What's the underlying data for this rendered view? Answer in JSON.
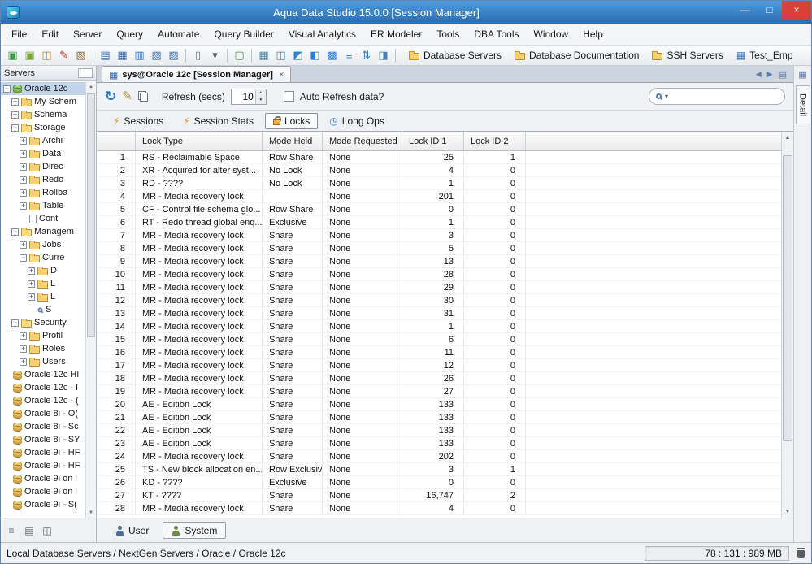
{
  "window": {
    "title": "Aqua Data Studio 15.0.0 [Session Manager]",
    "controls": {
      "minimize": "—",
      "maximize": "□",
      "close": "×"
    }
  },
  "menubar": {
    "items": [
      "File",
      "Edit",
      "Server",
      "Query",
      "Automate",
      "Query Builder",
      "Visual Analytics",
      "ER Modeler",
      "Tools",
      "DBA Tools",
      "Window",
      "Help"
    ]
  },
  "toolbar": {
    "icons": [
      {
        "name": "register-server-icon",
        "glyph": "▣",
        "color": "#3f9b4a"
      },
      {
        "name": "register-server-group-icon",
        "glyph": "▣",
        "color": "#7aa43c"
      },
      {
        "name": "import-servers-icon",
        "glyph": "◫",
        "color": "#b5893a"
      },
      {
        "name": "edit-server-icon",
        "glyph": "✎",
        "color": "#c0392b"
      },
      {
        "name": "scripting-icon",
        "glyph": "▧",
        "color": "#8e6f3a"
      },
      {
        "sep": true
      },
      {
        "name": "query-analyzer-icon",
        "glyph": "▤",
        "color": "#3a6fb0"
      },
      {
        "name": "results-grid-icon",
        "glyph": "▦",
        "color": "#3a6fb0"
      },
      {
        "name": "pin-results-icon",
        "glyph": "▥",
        "color": "#3a6fb0"
      },
      {
        "name": "export-grid-icon",
        "glyph": "▧",
        "color": "#3a6fb0"
      },
      {
        "name": "open-table-icon",
        "glyph": "▨",
        "color": "#3a6fb0"
      },
      {
        "sep": true
      },
      {
        "name": "paste-icon",
        "glyph": "▯",
        "color": "#777777"
      },
      {
        "name": "paste-options-icon",
        "glyph": "▾",
        "color": "#555555"
      },
      {
        "sep": true
      },
      {
        "name": "server-monitor-icon",
        "glyph": "▢",
        "color": "#4a8f4a"
      },
      {
        "sep": true
      },
      {
        "name": "grid-view-icon",
        "glyph": "▦",
        "color": "#4a7fb5"
      },
      {
        "name": "column-headers-icon",
        "glyph": "◫",
        "color": "#4a7fb5"
      },
      {
        "name": "split-top-icon",
        "glyph": "◩",
        "color": "#2a7fd4"
      },
      {
        "name": "split-left-icon",
        "glyph": "◧",
        "color": "#2a7fd4"
      },
      {
        "name": "grid-all-icon",
        "glyph": "▩",
        "color": "#2a7fd4"
      },
      {
        "name": "row-lines-icon",
        "glyph": "≡",
        "color": "#4a7fb5"
      },
      {
        "name": "sort-rows-icon",
        "glyph": "⇅",
        "color": "#4a7fb5"
      },
      {
        "name": "freeze-pane-icon",
        "glyph": "◨",
        "color": "#4a7fb5"
      },
      {
        "sep": true
      }
    ],
    "labeled_buttons": [
      {
        "name": "database-servers-button",
        "label": "Database Servers",
        "icon": "folder-icon"
      },
      {
        "name": "database-documentation-button",
        "label": "Database Documentation",
        "icon": "folder-icon"
      },
      {
        "name": "ssh-servers-button",
        "label": "SSH Servers",
        "icon": "folder-icon"
      },
      {
        "name": "test-emp-button",
        "label": "Test_Emp",
        "icon": "table-icon"
      }
    ]
  },
  "sidebar": {
    "header": "Servers",
    "tree": [
      {
        "label": "Oracle 12c",
        "level": 0,
        "toggle": "open",
        "icon": "db-green",
        "selected": true
      },
      {
        "label": "My Schem",
        "level": 1,
        "toggle": "closed",
        "icon": "folder"
      },
      {
        "label": "Schema",
        "level": 1,
        "toggle": "closed",
        "icon": "folder"
      },
      {
        "label": "Storage",
        "level": 1,
        "toggle": "open",
        "icon": "folder-open"
      },
      {
        "label": "Archi",
        "level": 2,
        "toggle": "closed",
        "icon": "folder"
      },
      {
        "label": "Data",
        "level": 2,
        "toggle": "closed",
        "icon": "folder"
      },
      {
        "label": "Direc",
        "level": 2,
        "toggle": "closed",
        "icon": "folder"
      },
      {
        "label": "Redo",
        "level": 2,
        "toggle": "closed",
        "icon": "folder"
      },
      {
        "label": "Rollba",
        "level": 2,
        "toggle": "closed",
        "icon": "folder"
      },
      {
        "label": "Table",
        "level": 2,
        "toggle": "closed",
        "icon": "folder"
      },
      {
        "label": "Cont",
        "level": 2,
        "toggle": "none",
        "icon": "page"
      },
      {
        "label": "Managem",
        "level": 1,
        "toggle": "open",
        "icon": "folder-open"
      },
      {
        "label": "Jobs",
        "level": 2,
        "toggle": "closed",
        "icon": "folder"
      },
      {
        "label": "Curre",
        "level": 2,
        "toggle": "open",
        "icon": "folder-open"
      },
      {
        "label": "D",
        "level": 3,
        "toggle": "closed",
        "icon": "folder"
      },
      {
        "label": "L",
        "level": 3,
        "toggle": "closed",
        "icon": "folder"
      },
      {
        "label": "L",
        "level": 3,
        "toggle": "closed",
        "icon": "folder"
      },
      {
        "label": "S",
        "level": 3,
        "toggle": "none",
        "icon": "magnifier"
      },
      {
        "label": "Security",
        "level": 1,
        "toggle": "open",
        "icon": "folder-open"
      },
      {
        "label": "Profil",
        "level": 2,
        "toggle": "closed",
        "icon": "folder"
      },
      {
        "label": "Roles",
        "level": 2,
        "toggle": "closed",
        "icon": "folder"
      },
      {
        "label": "Users",
        "level": 2,
        "toggle": "closed",
        "icon": "folder"
      },
      {
        "label": "Oracle 12c HI",
        "level": 0,
        "toggle": "none",
        "icon": "db"
      },
      {
        "label": "Oracle 12c - I",
        "level": 0,
        "toggle": "none",
        "icon": "db"
      },
      {
        "label": "Oracle 12c - (",
        "level": 0,
        "toggle": "none",
        "icon": "db"
      },
      {
        "label": "Oracle 8i - O(",
        "level": 0,
        "toggle": "none",
        "icon": "db"
      },
      {
        "label": "Oracle 8i - Sc",
        "level": 0,
        "toggle": "none",
        "icon": "db"
      },
      {
        "label": "Oracle 8i - SY",
        "level": 0,
        "toggle": "none",
        "icon": "db"
      },
      {
        "label": "Oracle 9i - HF",
        "level": 0,
        "toggle": "none",
        "icon": "db"
      },
      {
        "label": "Oracle 9i - HF",
        "level": 0,
        "toggle": "none",
        "icon": "db"
      },
      {
        "label": "Oracle 9i on l",
        "level": 0,
        "toggle": "none",
        "icon": "db"
      },
      {
        "label": "Oracle 9i on l",
        "level": 0,
        "toggle": "none",
        "icon": "db"
      },
      {
        "label": "Oracle 9i - S(",
        "level": 0,
        "toggle": "none",
        "icon": "db"
      }
    ]
  },
  "main": {
    "tab": {
      "label": "sys@Oracle 12c [Session Manager]",
      "close": "×"
    },
    "panel_toolbar": {
      "refresh_label": "Refresh (secs)",
      "refresh_value": "10",
      "auto_refresh_label": "Auto Refresh data?"
    },
    "subtabs": [
      {
        "label": "Sessions",
        "icon": "spark-icon",
        "selected": false
      },
      {
        "label": "Session Stats",
        "icon": "spark-icon",
        "selected": false
      },
      {
        "label": "Locks",
        "icon": "lock-icon",
        "selected": true
      },
      {
        "label": "Long Ops",
        "icon": "clock-icon",
        "selected": false
      }
    ],
    "table": {
      "columns": [
        "Lock Type",
        "Mode Held",
        "Mode Requested",
        "Lock ID 1",
        "Lock ID 2"
      ],
      "rows": [
        [
          "1",
          "RS - Reclaimable Space",
          "Row Share",
          "None",
          "25",
          "1"
        ],
        [
          "2",
          "XR - Acquired for alter syst...",
          "No Lock",
          "None",
          "4",
          "0"
        ],
        [
          "3",
          "RD - ????",
          "No Lock",
          "None",
          "1",
          "0"
        ],
        [
          "4",
          "MR - Media recovery lock",
          "",
          "None",
          "201",
          "0"
        ],
        [
          "5",
          "CF -  Control file schema glo...",
          "Row Share",
          "None",
          "0",
          "0"
        ],
        [
          "6",
          "RT - Redo thread global enq...",
          "Exclusive",
          "None",
          "1",
          "0"
        ],
        [
          "7",
          "MR - Media recovery lock",
          "Share",
          "None",
          "3",
          "0"
        ],
        [
          "8",
          "MR - Media recovery lock",
          "Share",
          "None",
          "5",
          "0"
        ],
        [
          "9",
          "MR - Media recovery lock",
          "Share",
          "None",
          "13",
          "0"
        ],
        [
          "10",
          "MR - Media recovery lock",
          "Share",
          "None",
          "28",
          "0"
        ],
        [
          "11",
          "MR - Media recovery lock",
          "Share",
          "None",
          "29",
          "0"
        ],
        [
          "12",
          "MR - Media recovery lock",
          "Share",
          "None",
          "30",
          "0"
        ],
        [
          "13",
          "MR - Media recovery lock",
          "Share",
          "None",
          "31",
          "0"
        ],
        [
          "14",
          "MR - Media recovery lock",
          "Share",
          "None",
          "1",
          "0"
        ],
        [
          "15",
          "MR - Media recovery lock",
          "Share",
          "None",
          "6",
          "0"
        ],
        [
          "16",
          "MR - Media recovery lock",
          "Share",
          "None",
          "11",
          "0"
        ],
        [
          "17",
          "MR - Media recovery lock",
          "Share",
          "None",
          "12",
          "0"
        ],
        [
          "18",
          "MR - Media recovery lock",
          "Share",
          "None",
          "26",
          "0"
        ],
        [
          "19",
          "MR - Media recovery lock",
          "Share",
          "None",
          "27",
          "0"
        ],
        [
          "20",
          "AE - Edition Lock",
          "Share",
          "None",
          "133",
          "0"
        ],
        [
          "21",
          "AE - Edition Lock",
          "Share",
          "None",
          "133",
          "0"
        ],
        [
          "22",
          "AE - Edition Lock",
          "Share",
          "None",
          "133",
          "0"
        ],
        [
          "23",
          "AE - Edition Lock",
          "Share",
          "None",
          "133",
          "0"
        ],
        [
          "24",
          "MR - Media recovery lock",
          "Share",
          "None",
          "202",
          "0"
        ],
        [
          "25",
          "TS - New block allocation en...",
          "Row Exclusive",
          "None",
          "3",
          "1"
        ],
        [
          "26",
          "KD - ????",
          "Exclusive",
          "None",
          "0",
          "0"
        ],
        [
          "27",
          "KT - ????",
          "Share",
          "None",
          "16,747",
          "2"
        ],
        [
          "28",
          "MR - Media recovery lock",
          "Share",
          "None",
          "4",
          "0"
        ]
      ]
    },
    "bottom_tabs": [
      {
        "label": "User",
        "icon": "user-icon",
        "selected": false
      },
      {
        "label": "System",
        "icon": "system-user-icon",
        "selected": true
      }
    ]
  },
  "detail_panel": {
    "label": "Detail"
  },
  "statusbar": {
    "path": "Local Database Servers / NextGen Servers / Oracle / Oracle 12c",
    "memory": "78 : 131 : 989 MB"
  }
}
